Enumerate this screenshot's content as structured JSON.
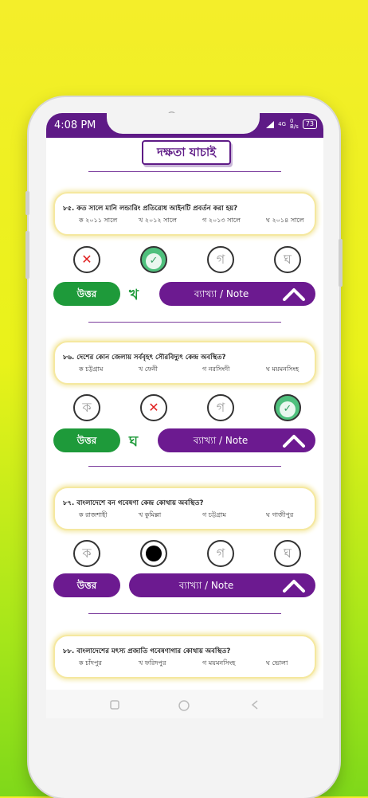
{
  "status_bar": {
    "time": "4:08 PM",
    "net_label": "4G",
    "speed": "0\nB/s",
    "battery": "73"
  },
  "header": {
    "title": "দক্ষতা যাচাই"
  },
  "questions": [
    {
      "text": "৮৫. কত সালে মানি লন্ডারিং প্রতিরোধ আইনটি প্রবর্তন করা হয়?",
      "options": [
        "ক ২০১১ সালে",
        "খ ২০১২ সালে",
        "গ ২০১৩ সালে",
        "ঘ ২০১৪ সালে"
      ],
      "circles": [
        "✕",
        "✓",
        "গ",
        "ঘ"
      ],
      "answer_label": "উত্তর",
      "answer_letter": "খ",
      "note_label": "ব্যাখ্যা / Note"
    },
    {
      "text": "৮৬. দেশের কোন জেলায় সর্ববৃহৎ সৌরবিদ্যুৎ কেন্দ্র অবস্থিত?",
      "options": [
        "ক চট্টগ্রাম",
        "খ ফেনী",
        "গ নরসিংদী",
        "ঘ ময়মনসিংহ"
      ],
      "circles": [
        "ক",
        "✕",
        "গ",
        "✓"
      ],
      "answer_label": "উত্তর",
      "answer_letter": "ঘ",
      "note_label": "ব্যাখ্যা / Note"
    },
    {
      "text": "৮৭. বাংলাদেশে বন গবেষণা কেন্দ্র কোথায় অবস্থিত?",
      "options": [
        "ক রাজশাহী",
        "খ কুমিল্লা",
        "গ চট্টগ্রাম",
        "ঘ গাজীপুর"
      ],
      "circles": [
        "ক",
        "",
        "গ",
        "ঘ"
      ],
      "answer_label": "উত্তর",
      "note_label": "ব্যাখ্যা / Note"
    },
    {
      "text": "৮৮. বাংলাদেশের মৎস্য প্রজাতি গবেষণাগার কোথায় অবস্থিত?",
      "options": [
        "ক চাঁদপুর",
        "খ ফরিদপুর",
        "গ ময়মনসিংহ",
        "ঘ ভোলা"
      ]
    }
  ],
  "colors": {
    "primary": "#6c1a90",
    "correct": "#1e9a3a",
    "wrong": "#e02020"
  }
}
